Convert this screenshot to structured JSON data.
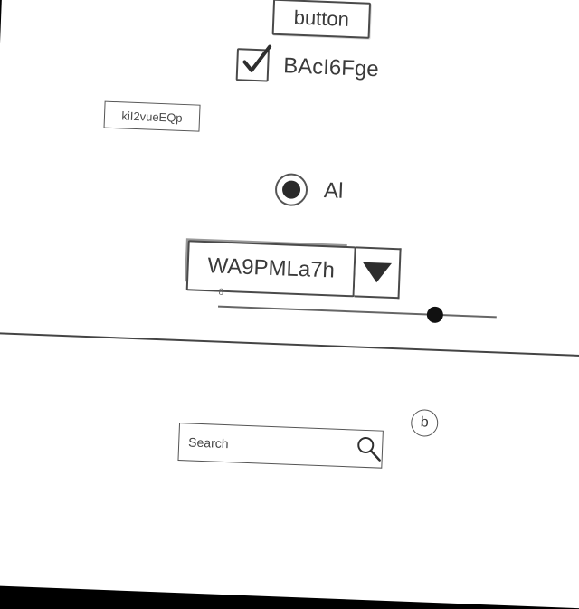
{
  "ui": {
    "button_label": "button",
    "checkbox": {
      "label": "BAcI6Fge",
      "checked": true
    },
    "tag_label": "kiI2vueEQp",
    "radio": {
      "label": "Al",
      "selected": true
    },
    "dropdown": {
      "value": "WA9PMLa7h"
    },
    "slider": {
      "label": "8",
      "value_fraction": 0.78
    },
    "info_badge": "b",
    "search": {
      "placeholder": "Search"
    }
  },
  "icons": {
    "checkmark": "checkmark-icon",
    "dropdown_arrow": "triangle-down-icon",
    "search": "magnifier-icon"
  },
  "colors": {
    "paper": "#ffffff",
    "outline": "#4a4a4a",
    "text": "#3b3b3b",
    "background": "#000000"
  }
}
